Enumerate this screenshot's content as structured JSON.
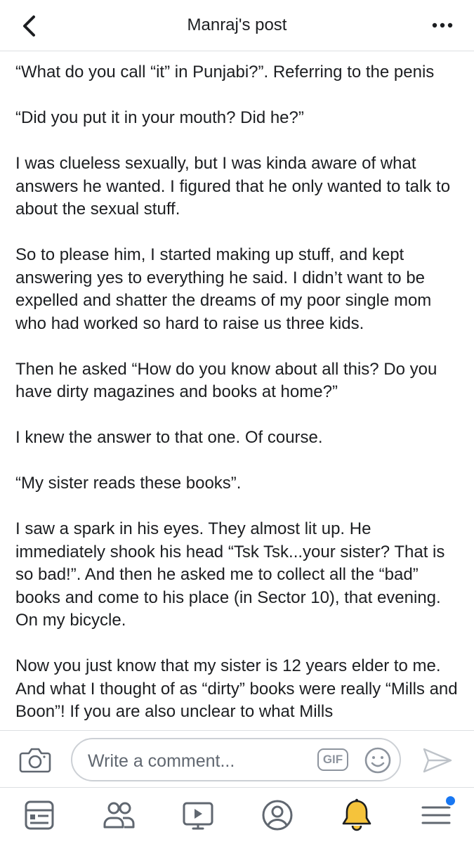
{
  "header": {
    "title": "Manraj's post",
    "back_icon": "chevron-left-icon",
    "more_icon": "more-dots-icon"
  },
  "post": {
    "paragraphs": [
      "“What do you call “it” in Punjabi?”. Referring to the penis",
      "“Did you put it in your mouth? Did he?”",
      "I was clueless sexually, but I was kinda aware of what answers he wanted. I figured that he only wanted to talk to about the sexual stuff.",
      "So to please him, I started making up stuff, and kept answering yes to everything he said. I didn’t want to be expelled and shatter the dreams of my poor single mom who had worked so hard to raise us three kids.",
      "Then he asked “How do you know about all this? Do you have dirty magazines and books at home?”",
      "I knew the answer to that one. Of course.",
      "“My sister reads these books”.",
      "I saw a spark in his eyes. They almost lit up. He immediately shook his head “Tsk Tsk...your sister? That is so bad!”. And then he asked me to collect all the “bad” books and come to his place (in Sector 10), that evening. On my bicycle.",
      "Now you just know that my sister is 12 years elder to me. And what I thought of as “dirty” books were really “Mills and Boon”! If you are also unclear to what Mills"
    ]
  },
  "comment_bar": {
    "placeholder": "Write a comment...",
    "gif_label": "GIF",
    "camera_icon": "camera-icon",
    "emoji_icon": "smiley-icon",
    "send_icon": "send-icon"
  },
  "tab_bar": {
    "tabs": [
      {
        "name": "news-feed",
        "icon": "news-feed-icon"
      },
      {
        "name": "groups",
        "icon": "people-icon"
      },
      {
        "name": "watch",
        "icon": "video-play-icon"
      },
      {
        "name": "profile",
        "icon": "profile-icon"
      },
      {
        "name": "notifications",
        "icon": "bell-icon",
        "active": true
      },
      {
        "name": "menu",
        "icon": "hamburger-menu-icon",
        "has_badge": true
      }
    ]
  },
  "colors": {
    "accent": "#1877f2",
    "bell": "#f5c33b",
    "icon_gray": "#606770",
    "divider": "#dddfe2"
  }
}
